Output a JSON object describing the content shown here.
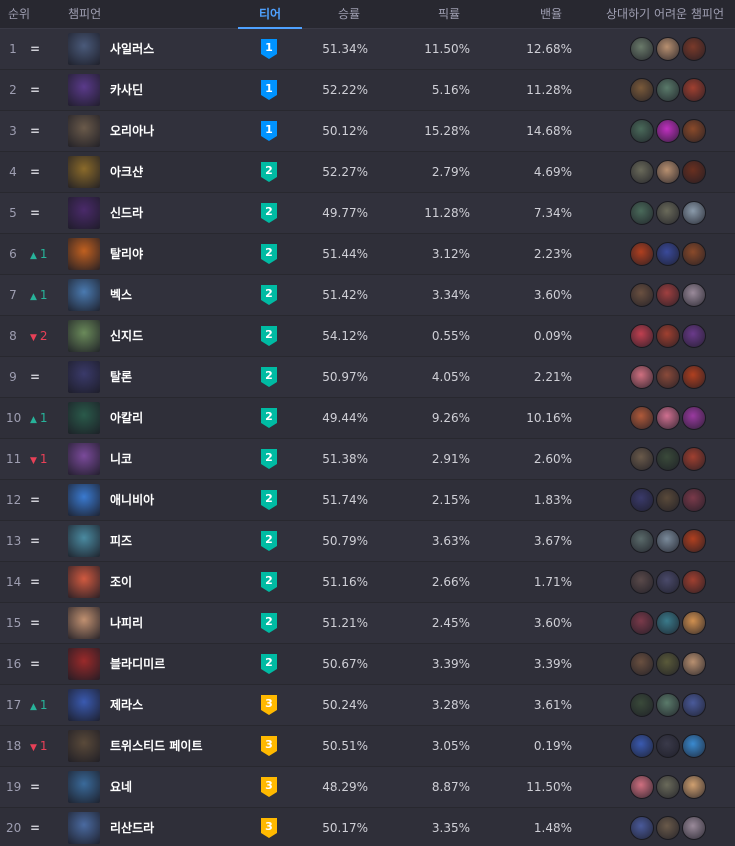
{
  "header": {
    "rank": "순위",
    "champion": "챔피언",
    "tier": "티어",
    "winrate": "승률",
    "pickrate": "픽률",
    "banrate": "밴율",
    "counters": "상대하기 어려운 챔피언"
  },
  "tier_colors": {
    "1": "#0093ff",
    "2": "#00bba3",
    "3": "#ffb900"
  },
  "rows": [
    {
      "rank": "1",
      "change": "=",
      "dir": "same",
      "name": "사일러스",
      "tier": "1",
      "win": "51.34%",
      "pick": "11.50%",
      "ban": "12.68%",
      "color": "#4a5a7a",
      "counters": [
        "#6a7a6a",
        "#b89070",
        "#7a3a2a"
      ]
    },
    {
      "rank": "2",
      "change": "=",
      "dir": "same",
      "name": "카사딘",
      "tier": "1",
      "win": "52.22%",
      "pick": "5.16%",
      "ban": "11.28%",
      "color": "#5a3a8a",
      "counters": [
        "#7a5a3a",
        "#5a7a6a",
        "#a04030"
      ]
    },
    {
      "rank": "3",
      "change": "=",
      "dir": "same",
      "name": "오리아나",
      "tier": "1",
      "win": "50.12%",
      "pick": "15.28%",
      "ban": "14.68%",
      "color": "#6a5a4a",
      "counters": [
        "#4a6a5a",
        "#c030c0",
        "#8a4a2a"
      ]
    },
    {
      "rank": "4",
      "change": "=",
      "dir": "same",
      "name": "아크샨",
      "tier": "2",
      "win": "52.27%",
      "pick": "2.79%",
      "ban": "4.69%",
      "color": "#8a6a2a",
      "counters": [
        "#6a6a5a",
        "#b89070",
        "#6a3020"
      ]
    },
    {
      "rank": "5",
      "change": "=",
      "dir": "same",
      "name": "신드라",
      "tier": "2",
      "win": "49.77%",
      "pick": "11.28%",
      "ban": "7.34%",
      "color": "#4a2a6a",
      "counters": [
        "#4a6a5a",
        "#6a6a5a",
        "#8a9aaa"
      ]
    },
    {
      "rank": "6",
      "change": "1",
      "dir": "up",
      "name": "탈리야",
      "tier": "2",
      "win": "51.44%",
      "pick": "3.12%",
      "ban": "2.23%",
      "color": "#c06020",
      "counters": [
        "#b04020",
        "#3a4a9a",
        "#8a4a2a"
      ]
    },
    {
      "rank": "7",
      "change": "1",
      "dir": "up",
      "name": "벡스",
      "tier": "2",
      "win": "51.42%",
      "pick": "3.34%",
      "ban": "3.60%",
      "color": "#4a7ab0",
      "counters": [
        "#6a5040",
        "#a04040",
        "#9a8a9a"
      ]
    },
    {
      "rank": "8",
      "change": "2",
      "dir": "down",
      "name": "신지드",
      "tier": "2",
      "win": "54.12%",
      "pick": "0.55%",
      "ban": "0.09%",
      "color": "#6a8a5a",
      "counters": [
        "#c04050",
        "#a04030",
        "#6a3a8a"
      ]
    },
    {
      "rank": "9",
      "change": "=",
      "dir": "same",
      "name": "탈론",
      "tier": "2",
      "win": "50.97%",
      "pick": "4.05%",
      "ban": "2.21%",
      "color": "#3a3a6a",
      "counters": [
        "#d07080",
        "#8a4a3a",
        "#b04020"
      ]
    },
    {
      "rank": "10",
      "change": "1",
      "dir": "up",
      "name": "아칼리",
      "tier": "2",
      "win": "49.44%",
      "pick": "9.26%",
      "ban": "10.16%",
      "color": "#2a5a4a",
      "counters": [
        "#b05a3a",
        "#d07090",
        "#9a3aa0"
      ]
    },
    {
      "rank": "11",
      "change": "1",
      "dir": "down",
      "name": "니코",
      "tier": "2",
      "win": "51.38%",
      "pick": "2.91%",
      "ban": "2.60%",
      "color": "#7a4a9a",
      "counters": [
        "#6a5a4a",
        "#3a4a3a",
        "#a04030"
      ]
    },
    {
      "rank": "12",
      "change": "=",
      "dir": "same",
      "name": "애니비아",
      "tier": "2",
      "win": "51.74%",
      "pick": "2.15%",
      "ban": "1.83%",
      "color": "#3a7ad0",
      "counters": [
        "#3a3a6a",
        "#5a4a3a",
        "#7a3a4a"
      ]
    },
    {
      "rank": "13",
      "change": "=",
      "dir": "same",
      "name": "피즈",
      "tier": "2",
      "win": "50.79%",
      "pick": "3.63%",
      "ban": "3.67%",
      "color": "#4a8aa0",
      "counters": [
        "#5a6a6a",
        "#7a8a9a",
        "#b04020"
      ]
    },
    {
      "rank": "14",
      "change": "=",
      "dir": "same",
      "name": "조이",
      "tier": "2",
      "win": "51.16%",
      "pick": "2.66%",
      "ban": "1.71%",
      "color": "#d05a40",
      "counters": [
        "#5a4a4a",
        "#4a4a6a",
        "#a04030"
      ]
    },
    {
      "rank": "15",
      "change": "=",
      "dir": "same",
      "name": "나피리",
      "tier": "2",
      "win": "51.21%",
      "pick": "2.45%",
      "ban": "3.60%",
      "color": "#c09070",
      "counters": [
        "#7a3a4a",
        "#3a7a8a",
        "#d09050"
      ]
    },
    {
      "rank": "16",
      "change": "=",
      "dir": "same",
      "name": "블라디미르",
      "tier": "2",
      "win": "50.67%",
      "pick": "3.39%",
      "ban": "3.39%",
      "color": "#9a2a2a",
      "counters": [
        "#6a5040",
        "#5a5a3a",
        "#b89070"
      ]
    },
    {
      "rank": "17",
      "change": "1",
      "dir": "up",
      "name": "제라스",
      "tier": "3",
      "win": "50.24%",
      "pick": "3.28%",
      "ban": "3.61%",
      "color": "#3a5ab0",
      "counters": [
        "#3a4a3a",
        "#5a7a6a",
        "#4a5a9a"
      ]
    },
    {
      "rank": "18",
      "change": "1",
      "dir": "down",
      "name": "트위스티드 페이트",
      "tier": "3",
      "win": "50.51%",
      "pick": "3.05%",
      "ban": "0.19%",
      "color": "#5a4a3a",
      "counters": [
        "#3a5ab0",
        "#3a3a4a",
        "#3a8ad0"
      ]
    },
    {
      "rank": "19",
      "change": "=",
      "dir": "same",
      "name": "요네",
      "tier": "3",
      "win": "48.29%",
      "pick": "8.87%",
      "ban": "11.50%",
      "color": "#3a6a9a",
      "counters": [
        "#d07080",
        "#6a6a5a",
        "#d0a070"
      ]
    },
    {
      "rank": "20",
      "change": "=",
      "dir": "same",
      "name": "리산드라",
      "tier": "3",
      "win": "50.17%",
      "pick": "3.35%",
      "ban": "1.48%",
      "color": "#4a6aa0",
      "counters": [
        "#4a5a9a",
        "#6a5a4a",
        "#9a8a9a"
      ]
    }
  ]
}
